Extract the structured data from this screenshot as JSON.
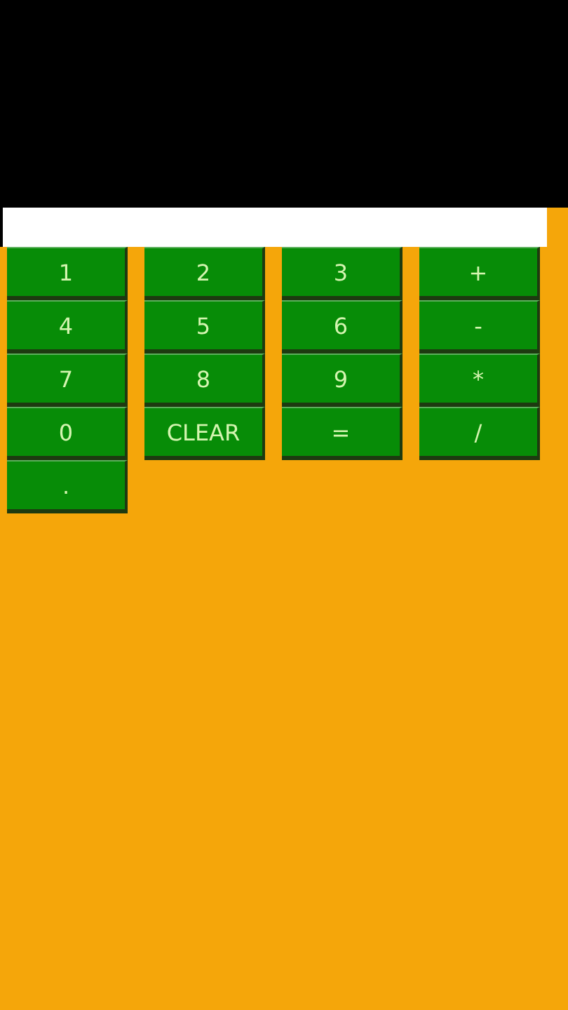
{
  "keys": [
    "1",
    "2",
    "3",
    "+",
    "4",
    "5",
    "6",
    "-",
    "7",
    "8",
    "9",
    "*",
    "0",
    "CLEAR",
    "=",
    "/",
    "."
  ]
}
